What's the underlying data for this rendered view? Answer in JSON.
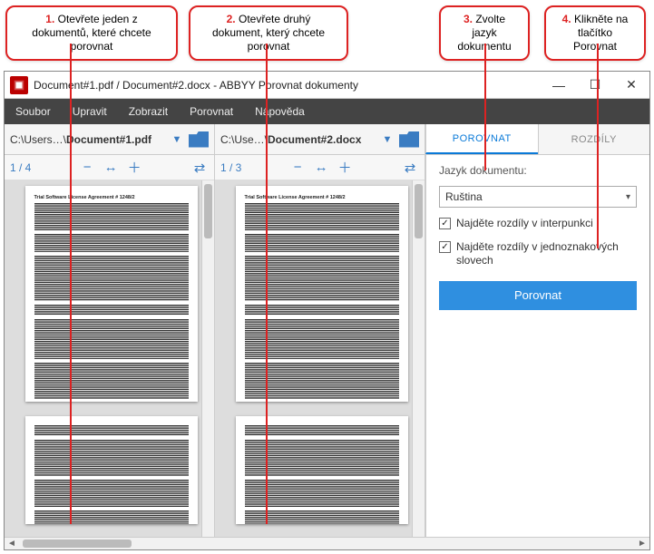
{
  "callouts": [
    {
      "num": "1.",
      "text": "Otevřete jeden z dokumentů, které chcete porovnat"
    },
    {
      "num": "2.",
      "text": "Otevřete druhý dokument, který chcete porovnat"
    },
    {
      "num": "3.",
      "text": "Zvolte jazyk dokumentu"
    },
    {
      "num": "4.",
      "text": "Klikněte na tlačítko Porovnat"
    }
  ],
  "window": {
    "title": "Document#1.pdf / Document#2.docx - ABBYY Porovnat dokumenty"
  },
  "menu": {
    "file": "Soubor",
    "edit": "Upravit",
    "view": "Zobrazit",
    "compare": "Porovnat",
    "help": "Nápověda"
  },
  "files": {
    "left_prefix": "C:\\Users…\\",
    "left_name": "Document#1.pdf",
    "right_prefix": "C:\\Use…\\",
    "right_name": "Document#2.docx"
  },
  "tabs": {
    "compare": "POROVNAT",
    "diffs": "ROZDÍLY"
  },
  "pageinfo": {
    "left": "1 / 4",
    "right": "1 / 3"
  },
  "doc_preview": {
    "title": "Trial Software License Agreement # 1248/2"
  },
  "side": {
    "lang_label": "Jazyk dokumentu:",
    "lang_value": "Ruština",
    "chk_punct": "Najděte rozdíly v interpunkci",
    "chk_singlechar": "Najděte rozdíly v jednoznakových slovech",
    "compare_btn": "Porovnat"
  }
}
